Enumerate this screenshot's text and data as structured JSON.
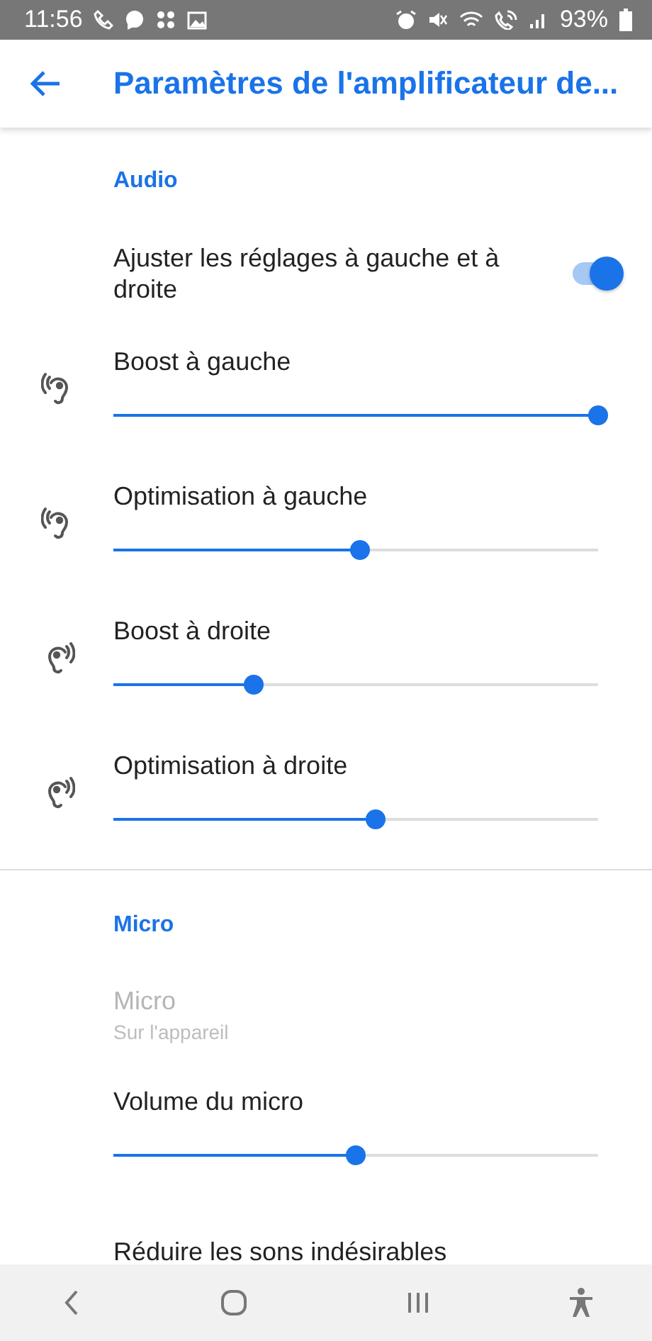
{
  "status_bar": {
    "time": "11:56",
    "battery": "93%"
  },
  "header": {
    "title": "Paramètres de l'amplificateur de..."
  },
  "sections": [
    {
      "title": "Audio",
      "items": [
        {
          "kind": "toggle",
          "label": "Ajuster les réglages à gauche et à droite",
          "on": true
        },
        {
          "kind": "left-ear-slider",
          "label": "Boost à gauche",
          "level": 1.0
        },
        {
          "kind": "left-ear-slider",
          "label": "Optimisation à gauche",
          "level": 0.51
        },
        {
          "kind": "right-ear-slider",
          "label": "Boost à droite",
          "level": 0.29
        },
        {
          "kind": "right-ear-slider",
          "label": "Optimisation à droite",
          "level": 0.54
        }
      ]
    },
    {
      "title": "Micro",
      "items": [
        {
          "kind": "info",
          "label": "Micro",
          "summary": "Sur l'appareil",
          "disabled": true
        },
        {
          "kind": "slider",
          "label": "Volume du micro",
          "level": 0.5
        },
        {
          "kind": "text",
          "label": "Réduire les sons indésirables"
        }
      ]
    }
  ]
}
